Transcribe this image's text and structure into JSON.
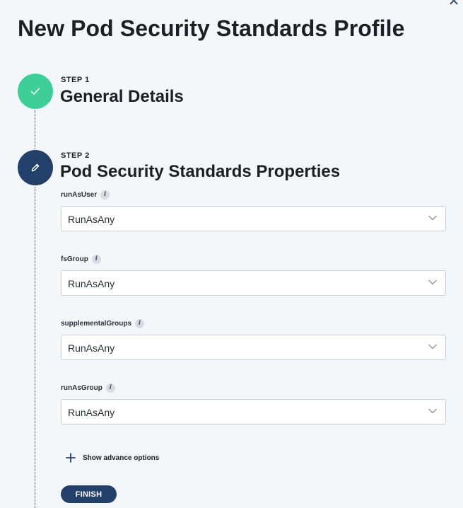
{
  "page": {
    "title": "New Pod Security Standards Profile"
  },
  "close": {
    "icon": "close-icon",
    "glyph": "✕"
  },
  "colors": {
    "step_done": "#3ecf98",
    "step_active": "#23406a",
    "primary_button": "#23406a"
  },
  "steps": [
    {
      "label": "STEP 1",
      "title": "General Details",
      "status": "completed",
      "icon": "checkmark-icon"
    },
    {
      "label": "STEP 2",
      "title": "Pod Security Standards Properties",
      "status": "active",
      "icon": "pencil-icon"
    }
  ],
  "fields": [
    {
      "label": "runAsUser",
      "value": "RunAsAny"
    },
    {
      "label": "fsGroup",
      "value": "RunAsAny"
    },
    {
      "label": "supplementalGroups",
      "value": "RunAsAny"
    },
    {
      "label": "runAsGroup",
      "value": "RunAsAny"
    }
  ],
  "advanced": {
    "label": "Show advance options",
    "icon": "plus-icon"
  },
  "actions": {
    "finish_label": "FINISH"
  }
}
